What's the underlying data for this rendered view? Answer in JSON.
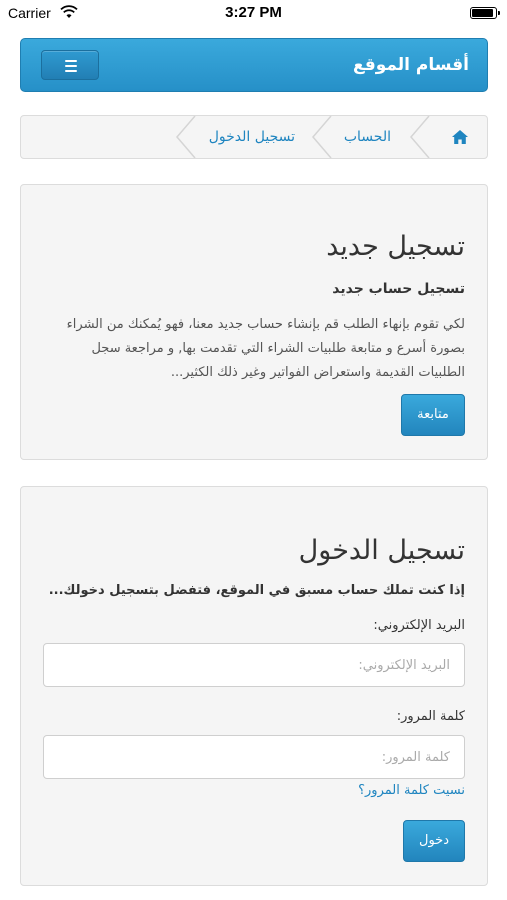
{
  "status_bar": {
    "carrier": "Carrier",
    "time": "3:27 PM",
    "battery_level": 0.95
  },
  "navbar": {
    "brand": "أقسام الموقع",
    "menu_icon": "hamburger-icon",
    "accent_color": "#2a9bd4"
  },
  "breadcrumb": {
    "home_icon": "home-icon",
    "items": [
      "الحساب",
      "تسجيل الدخول"
    ]
  },
  "register": {
    "title": "تسجيل جديد",
    "subtitle": "تسجيل حساب جديد",
    "description": "لكي تقوم بإنهاء الطلب قم بإنشاء حساب جديد معنا، فهو يُمكنك من الشراء بصورة أسرع و متابعة طلبيات الشراء التي تقدمت بها, و مراجعة سجل الطلبيات القديمة واستعراض الفواتير وغير ذلك الكثير...",
    "continue_label": "متابعة"
  },
  "login": {
    "title": "تسجيل الدخول",
    "intro": "إذا كنت تملك حساب مسبق في الموقع، فتفضل بتسجيل دخولك...",
    "email_label": "البريد الإلكتروني:",
    "email_placeholder": "البريد الإلكتروني:",
    "email_value": "",
    "password_label": "كلمة المرور:",
    "password_placeholder": "كلمة المرور:",
    "password_value": "",
    "forgot_label": "نسيت كلمة المرور؟",
    "submit_label": "دخول"
  }
}
